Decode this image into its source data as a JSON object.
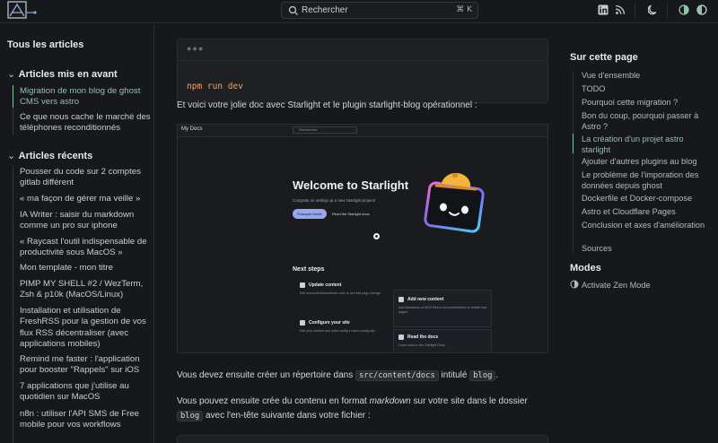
{
  "header": {
    "search_placeholder": "Rechercher",
    "search_shortcut": "⌘ K"
  },
  "sidebar": {
    "all_articles": "Tous les articles",
    "featured_title": "Articles mis en avant",
    "featured": [
      {
        "label": "Migration de mon blog de ghost CMS vers astro",
        "active": true
      },
      {
        "label": "Ce que nous cache le marché des téléphones reconditionnés",
        "active": false
      }
    ],
    "recent_title": "Articles récents",
    "recent": [
      {
        "label": "Pousser du code sur 2 comptes gitlab différent"
      },
      {
        "label": "« ma façon de gérer ma veille »"
      },
      {
        "label": "IA Writer : saisir du markdown comme un pro sur iphone"
      },
      {
        "label": "« Raycast l'outil indispensable de productivité sous MacOS »"
      },
      {
        "label": "Mon template - mon titre"
      },
      {
        "label": "PIMP MY SHELL #2 / WezTerm, Zsh & p10k (MacOS/Linux)"
      },
      {
        "label": "Installation et utilisation de FreshRSS pour la gestion de vos flux RSS décentraliser (avec applications mobiles)"
      },
      {
        "label": "Remind me faster : l'application pour booster \"Rappels\" sur iOS"
      },
      {
        "label": "7 applications que j'utilise au quotidien sur MacOS"
      },
      {
        "label": "n8n : utiliser l'API SMS de Free mobile pour vos workflows"
      }
    ]
  },
  "main": {
    "code_command": "npm run dev",
    "para1": "Et voici votre jolie doc avec Starlight et le plugin starlight-blog opérationnel :",
    "para2_a": "Vous devez ensuite créer un répertoire dans ",
    "para2_code1": "src/content/docs",
    "para2_b": " intitulé ",
    "para2_code2": "blog",
    "para2_c": ".",
    "para3_a": "Vous pouvez ensuite crée du contenu en format ",
    "para3_em": "markdown",
    "para3_b": " sur votre site dans le dossier ",
    "para3_code": "blog",
    "para3_c": " avec l'en-tête suivante dans votre fichier :"
  },
  "screenshot": {
    "site_title": "My Docs",
    "search": "Rechercher",
    "hero_title": "Welcome to Starlight",
    "hero_sub": "Congrats on setting up a new Starlight project!",
    "btn_primary": "Example Guide",
    "btn_secondary": "Read the Starlight docs",
    "next_steps": "Next steps",
    "cards": [
      {
        "title": "Update content",
        "desc": "Edit src/content/docs/index.mdx to see this page change."
      },
      {
        "title": "Add new content",
        "desc": "Add Markdown or MDX files to src/content/docs to create new pages."
      },
      {
        "title": "Configure your site",
        "desc": "Edit your sidebar and other config in astro.config.mjs."
      },
      {
        "title": "Read the docs",
        "desc": "Learn more in the Starlight Docs."
      }
    ]
  },
  "toc": {
    "title": "Sur cette page",
    "items": [
      {
        "label": "Vue d'ensemble",
        "active": false
      },
      {
        "label": "TODO",
        "active": false
      },
      {
        "label": "Pourquoi cette migration ?",
        "active": false
      },
      {
        "label": "Bon du coup, pourquoi passer à Astro ?",
        "active": false
      },
      {
        "label": "La création d'un projet astro starlight",
        "active": true
      },
      {
        "label": "Ajouter d'autres plugins au blog",
        "active": false
      },
      {
        "label": "Le problème de l'imporation des données depuis ghost",
        "active": false
      },
      {
        "label": "Dockerfile et Docker-compose",
        "active": false
      },
      {
        "label": "Astro et Cloudflare Pages",
        "active": false
      },
      {
        "label": "Conclusion et axes d'amélioration",
        "active": false
      },
      {
        "label": "Sources",
        "active": false
      }
    ],
    "modes_title": "Modes",
    "zen": "Activate Zen Mode"
  },
  "colors": {
    "accent": "#8cc4a6",
    "background": "#17181c"
  }
}
